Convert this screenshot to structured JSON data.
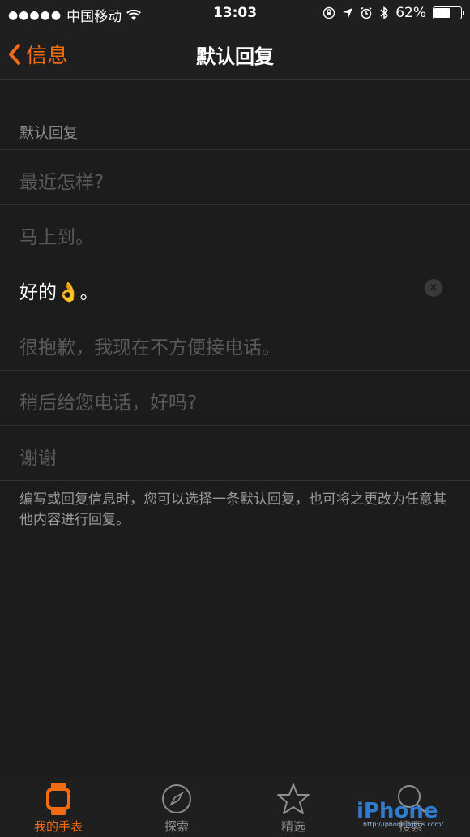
{
  "status_bar": {
    "carrier": "中国移动",
    "time": "13:03",
    "battery_percent": "62%",
    "battery_level": 0.62
  },
  "nav": {
    "back_label": "信息",
    "title": "默认回复",
    "accent_color": "#f36b12"
  },
  "section": {
    "header": "默认回复",
    "replies": [
      {
        "text": "最近怎样?"
      },
      {
        "text": "马上到。"
      },
      {
        "text_prefix": "好的",
        "emoji": "👌",
        "text_suffix": "。"
      },
      {
        "text": "很抱歉，我现在不方便接电话。"
      },
      {
        "text": "稍后给您电话，好吗?"
      },
      {
        "text": "谢谢"
      }
    ],
    "footnote": "编写或回复信息时，您可以选择一条默认回复，也可将之更改为任意其他内容进行回复。"
  },
  "tab_bar": {
    "tabs": [
      {
        "label": "我的手表",
        "icon": "watch-icon",
        "active": true
      },
      {
        "label": "探索",
        "icon": "compass-icon",
        "active": false
      },
      {
        "label": "精选",
        "icon": "star-icon",
        "active": false
      },
      {
        "label": "搜索",
        "icon": "search-icon",
        "active": false
      }
    ]
  },
  "watermark": {
    "brand": "iPhone",
    "url": "http://iphone.tgbus.com/"
  }
}
